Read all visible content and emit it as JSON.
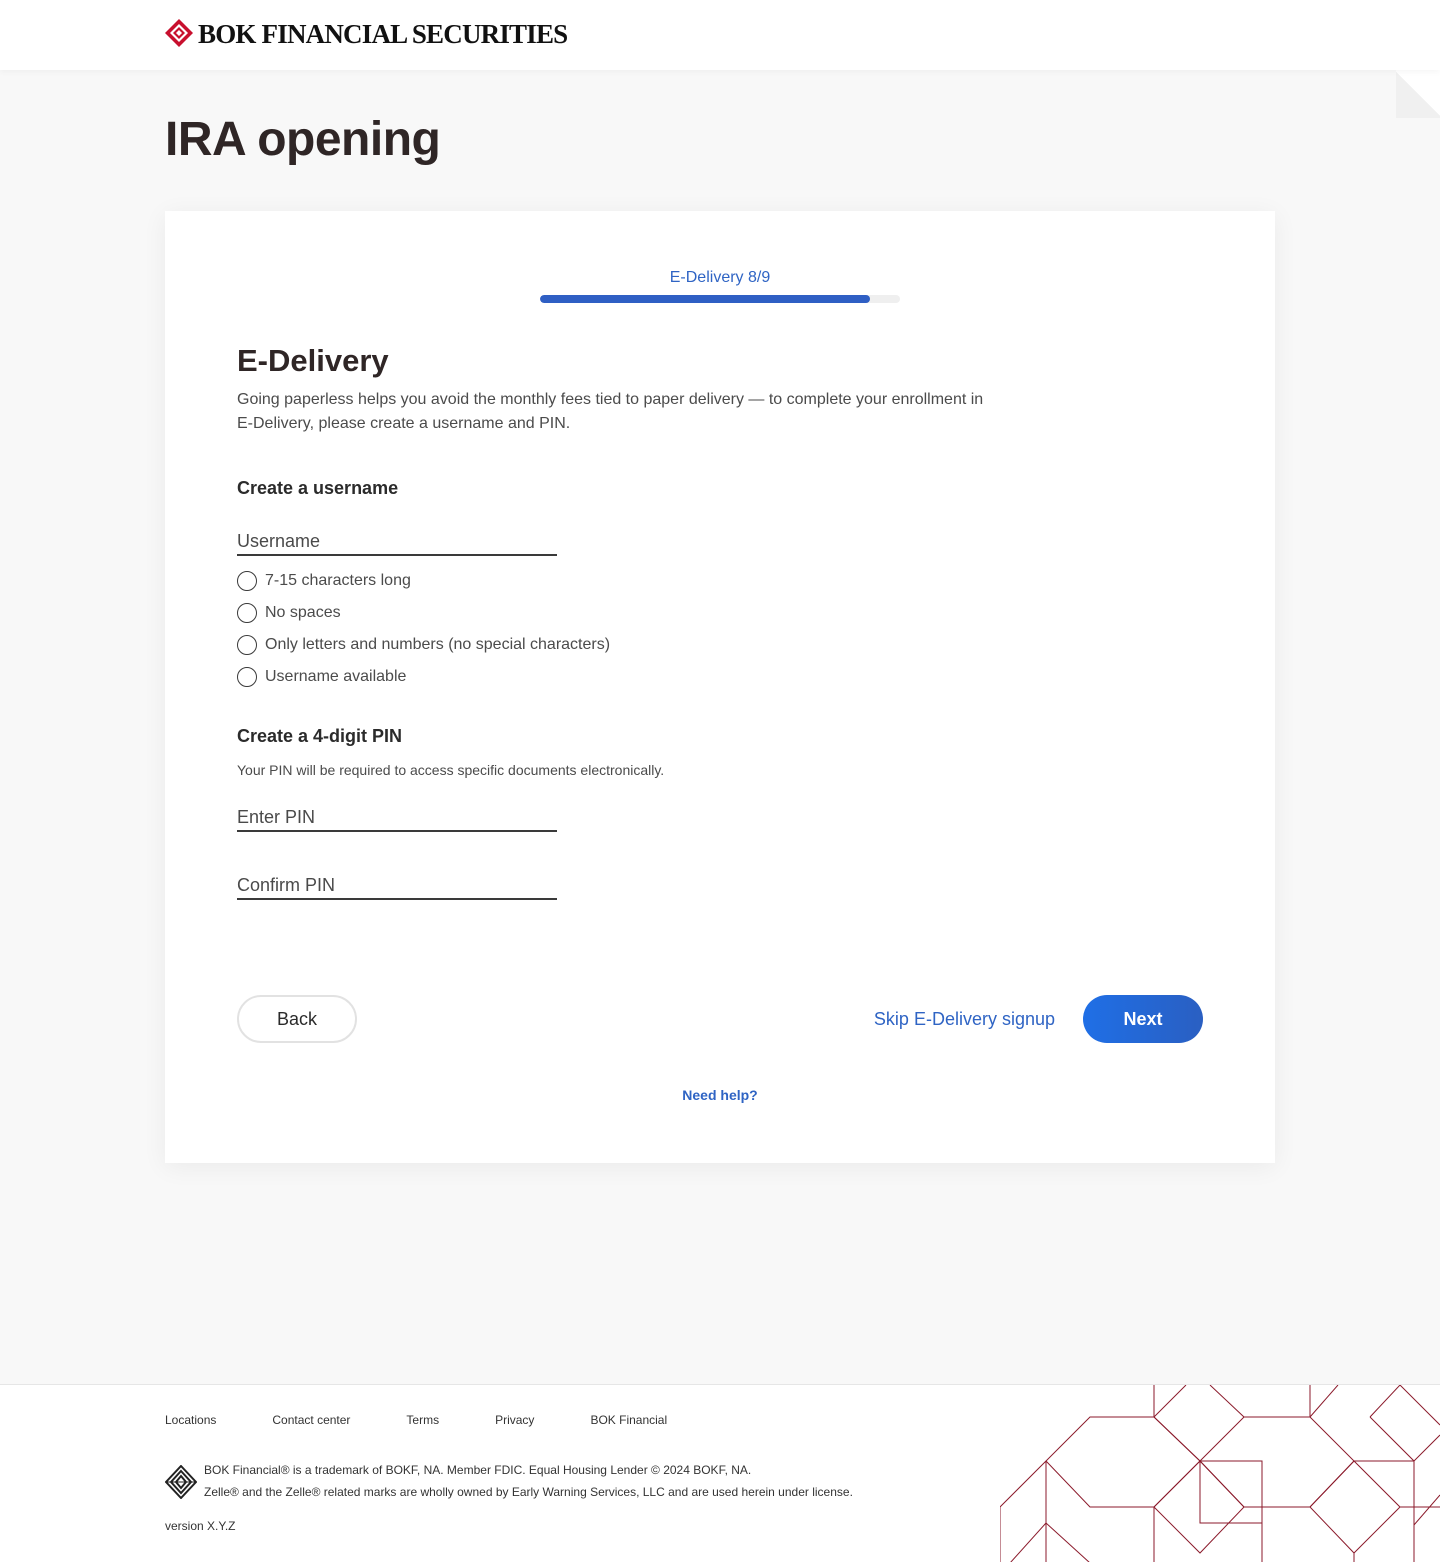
{
  "header": {
    "brand": "BOK FINANCIAL SECURITIES",
    "page_title": "IRA opening"
  },
  "progress": {
    "label": "E-Delivery 8/9",
    "step": 8,
    "total": 9,
    "fraction": 0.917
  },
  "form": {
    "title": "E-Delivery",
    "intro": "Going paperless helps you avoid the monthly fees tied to paper delivery — to complete your enrollment in E-Delivery, please create a username and PIN.",
    "username_heading": "Create a username",
    "username_placeholder": "Username",
    "username_rules": [
      "7-15 characters long",
      "No spaces",
      "Only letters and numbers (no special characters)",
      "Username available"
    ],
    "pin_heading": "Create a 4-digit PIN",
    "pin_note": "Your PIN will be required to access specific documents electronically.",
    "pin_placeholder": "Enter PIN",
    "confirm_pin_placeholder": "Confirm PIN"
  },
  "actions": {
    "back": "Back",
    "skip": "Skip E-Delivery signup",
    "next": "Next",
    "help": "Need help?"
  },
  "footer": {
    "links": [
      "Locations",
      "Contact center",
      "Terms",
      "Privacy",
      "BOK Financial"
    ],
    "legal_line_1": "BOK Financial® is a trademark of BOKF, NA. Member FDIC. Equal Housing Lender  © 2024 BOKF, NA.",
    "legal_line_2": "Zelle® and the Zelle® related marks are wholly owned by Early Warning Services, LLC and are used herein under license.",
    "version": "version X.Y.Z"
  },
  "colors": {
    "brand_red": "#c8102e",
    "link_blue": "#2f64c4",
    "primary_button": "#1f6fe6",
    "pattern_red": "#8b1a2b"
  },
  "icons": [
    "bok-logo-icon",
    "radio-circle-icon",
    "bok-mark-icon"
  ]
}
